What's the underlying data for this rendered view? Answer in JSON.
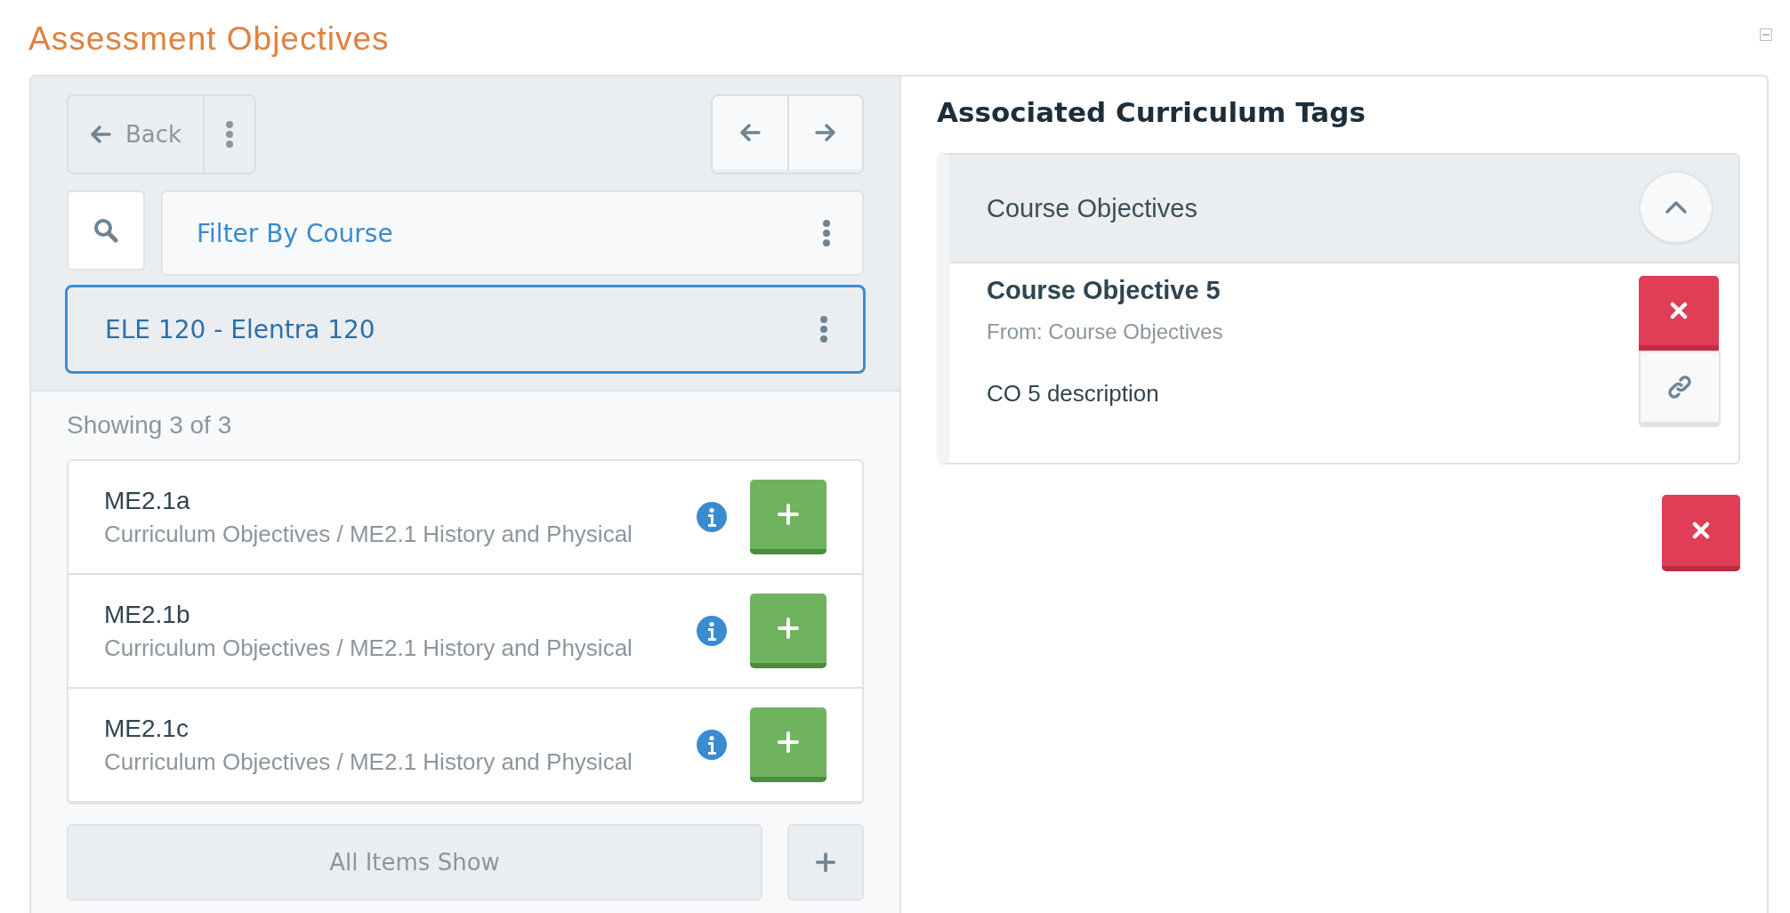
{
  "section": {
    "title": "Assessment Objectives"
  },
  "browser": {
    "back_button": "Back",
    "filter": "Filter By Course",
    "selected_course": "ELE 120 - Elentra 120",
    "count": "Showing 3 of 3",
    "items": [
      {
        "code": "ME2.1a",
        "path": "Curriculum Objectives / ME2.1 History and Physical"
      },
      {
        "code": "ME2.1b",
        "path": "Curriculum Objectives / ME2.1 History and Physical"
      },
      {
        "code": "ME2.1c",
        "path": "Curriculum Objectives / ME2.1 History and Physical"
      }
    ],
    "show_all_button": "All Items Show"
  },
  "tags_panel": {
    "heading": "Associated Curriculum Tags",
    "groups": [
      {
        "title": "Course Objectives",
        "expanded": true,
        "tags": [
          {
            "title": "Course Objective 5",
            "source": "From: Course Objectives",
            "description": "CO 5 description"
          }
        ]
      }
    ]
  }
}
